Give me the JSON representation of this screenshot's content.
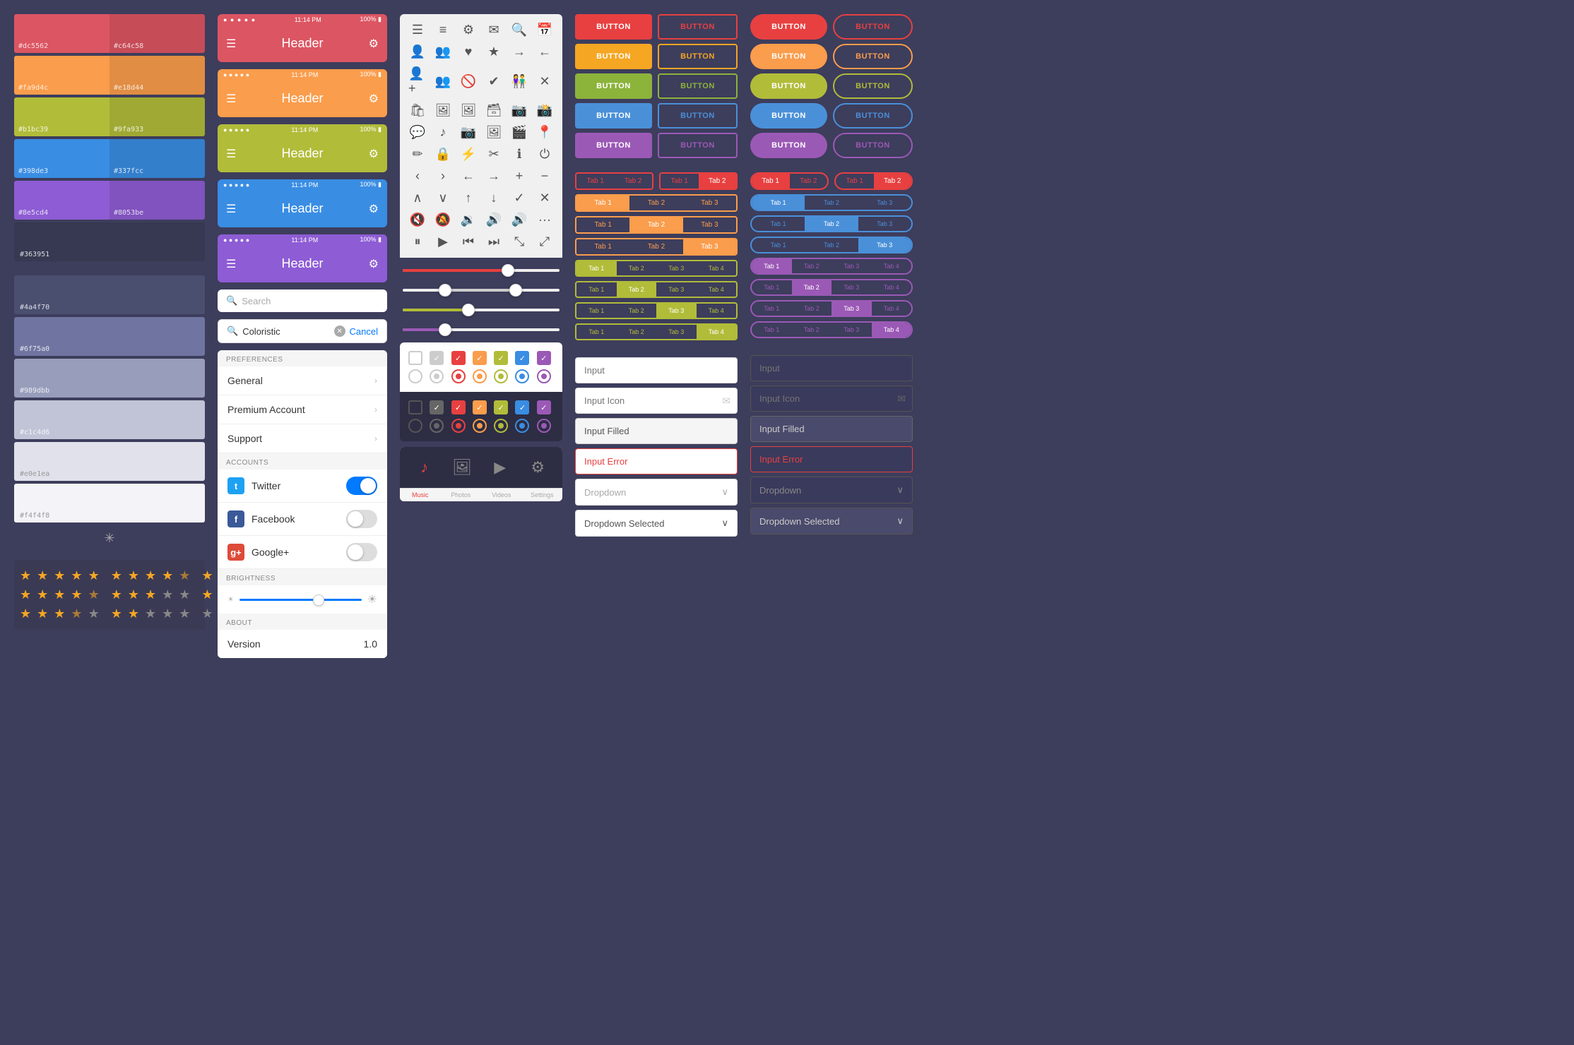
{
  "swatches": {
    "group1": [
      {
        "left": "#dc5562",
        "right": "#c64c58"
      },
      {
        "left": "#fa9d4c",
        "right": "#e18d44"
      },
      {
        "left": "#b1bc39",
        "right": "#9fa933"
      },
      {
        "left": "#398de3",
        "right": "#337fcc"
      },
      {
        "left": "#8e5cd4",
        "right": "#8053be"
      },
      {
        "single": "#363951"
      }
    ],
    "group2": [
      {
        "single": "#4a4f70"
      },
      {
        "single": "#6f75a0"
      },
      {
        "single": "#989dbb"
      },
      {
        "single": "#c1c4d6"
      },
      {
        "single": "#e0e1ea"
      },
      {
        "single": "#f4f4f8"
      }
    ]
  },
  "mobile": {
    "headers": [
      {
        "color": "#dc5562",
        "title": "Header"
      },
      {
        "color": "#fa9d4c",
        "title": "Header"
      },
      {
        "color": "#b1bc39",
        "title": "Header"
      },
      {
        "color": "#398de3",
        "title": "Header"
      },
      {
        "color": "#8e5cd4",
        "title": "Header"
      }
    ],
    "search_placeholder": "Search",
    "active_search_value": "Coloristic",
    "cancel_label": "Cancel",
    "preferences": {
      "section": "PREFERENCES",
      "items": [
        "General",
        "Premium Account",
        "Support"
      ]
    },
    "accounts": {
      "section": "ACCOUNTS",
      "items": [
        {
          "name": "Twitter",
          "color": "#1da1f2",
          "enabled": true
        },
        {
          "name": "Facebook",
          "color": "#3b5998",
          "enabled": false
        },
        {
          "name": "Google+",
          "color": "#dd4b39",
          "enabled": false
        }
      ]
    },
    "brightness": {
      "section": "BRIGHTNESS"
    },
    "about": {
      "section": "ABOUT",
      "version_label": "Version",
      "version_value": "1.0"
    },
    "tab_bar": [
      {
        "label": "Music",
        "icon": "♪"
      },
      {
        "label": "Photos",
        "icon": "⊞"
      },
      {
        "label": "Videos",
        "icon": "▶"
      },
      {
        "label": "Settings",
        "icon": "⚙"
      }
    ]
  },
  "buttons": {
    "label": "BUTTON",
    "colors": [
      "red",
      "orange",
      "olive",
      "blue",
      "purple"
    ]
  },
  "tabs": {
    "tab1": "Tab 1",
    "tab2": "Tab 2",
    "tab3": "Tab 3",
    "tab4": "Tab 4"
  },
  "inputs": {
    "placeholder": "Input",
    "icon_placeholder": "Input Icon",
    "filled_value": "Input Filled",
    "error_value": "Input Error",
    "dropdown_placeholder": "Dropdown",
    "dropdown_selected": "Dropdown Selected"
  }
}
